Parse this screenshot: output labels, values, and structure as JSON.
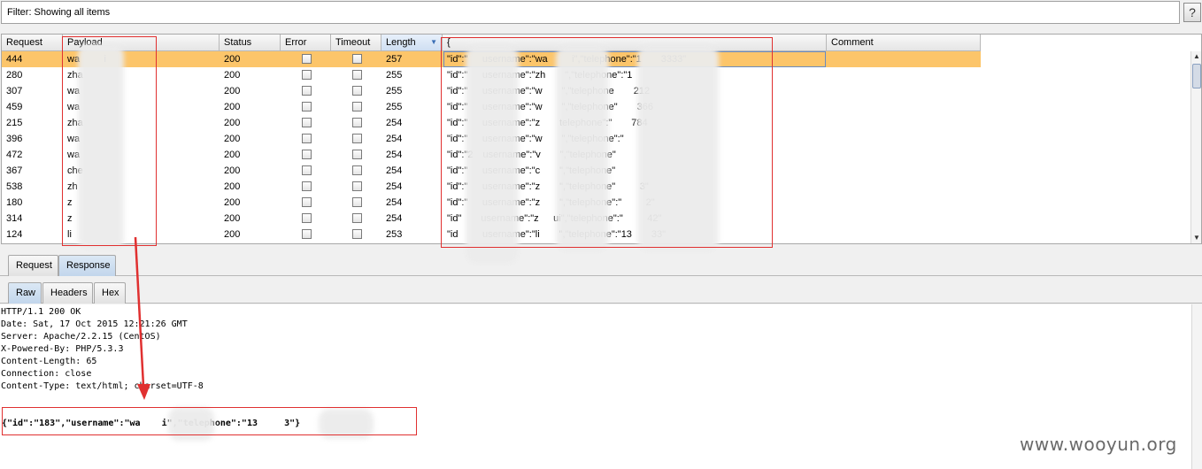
{
  "filter": {
    "text": "Filter:  Showing all items",
    "help_label": "?"
  },
  "table": {
    "columns": [
      "Request",
      "Payload",
      "Status",
      "Error",
      "Timeout",
      "Length",
      "{",
      "Comment"
    ],
    "sorted_column": "Length",
    "rows": [
      {
        "request": "444",
        "payload": "wa     i",
        "status": "200",
        "length": "257",
        "response": "\"id\":\"   username\":\"wa     i\",\"telephone\":\"1    3333\"",
        "selected": true
      },
      {
        "request": "280",
        "payload": "zha",
        "status": "200",
        "length": "255",
        "response": "\"id\":\"   username\":\"zh    \",\"telephone\":\"1    ",
        "selected": false
      },
      {
        "request": "307",
        "payload": "wa",
        "status": "200",
        "length": "255",
        "response": "\"id\":\"   username\":\"w    \",\"telephone    212",
        "selected": false
      },
      {
        "request": "459",
        "payload": "wa",
        "status": "200",
        "length": "255",
        "response": "\"id\":\"   username\":\"w    \",\"telephone\"    366",
        "selected": false
      },
      {
        "request": "215",
        "payload": "zha",
        "status": "200",
        "length": "254",
        "response": "\"id\":\"   username\":\"z    telephone\":\"    784",
        "selected": false
      },
      {
        "request": "396",
        "payload": "wa",
        "status": "200",
        "length": "254",
        "response": "\"id\":\"   username\":\"w    \",\"telephone\":\"    ",
        "selected": false
      },
      {
        "request": "472",
        "payload": "wa",
        "status": "200",
        "length": "254",
        "response": "\"id\":\"2  username\":\"v    \",\"telephone\"    ",
        "selected": false
      },
      {
        "request": "367",
        "payload": "che",
        "status": "200",
        "length": "254",
        "response": "\"id\":\"   username\":\"c    \",\"telephone\"    ",
        "selected": false
      },
      {
        "request": "538",
        "payload": "zh",
        "status": "200",
        "length": "254",
        "response": "\"id\":\"   username\":\"z    \",\"telephone\"     3\"",
        "selected": false
      },
      {
        "request": "180",
        "payload": "z",
        "status": "200",
        "length": "254",
        "response": "\"id\":\"   username\":\"z    \",\"telephone\":\"     2\"",
        "selected": false
      },
      {
        "request": "314",
        "payload": "z",
        "status": "200",
        "length": "254",
        "response": "\"id\"    username\":\"z   ui\",\"telephone\":\"     42\"",
        "selected": false
      },
      {
        "request": "124",
        "payload": "li",
        "status": "200",
        "length": "253",
        "response": "\"id     username\":\"li    \",\"telephone\":\"13    33\"",
        "selected": false
      }
    ]
  },
  "tabs": {
    "request": "Request",
    "response": "Response",
    "active": "Response"
  },
  "subtabs": {
    "raw": "Raw",
    "headers": "Headers",
    "hex": "Hex",
    "active": "Raw"
  },
  "raw": {
    "lines": [
      "HTTP/1.1 200 OK",
      "Date: Sat, 17 Oct 2015 12:21:26 GMT",
      "Server: Apache/2.2.15 (CentOS)",
      "X-Powered-By: PHP/5.3.3",
      "Content-Length: 65",
      "Connection: close",
      "Content-Type: text/html; charset=UTF-8"
    ],
    "body": "{\"id\":\"183\",\"username\":\"wa    i\",\"telephone\":\"13     3\"}"
  },
  "watermark": "www.wooyun.org",
  "colors": {
    "selected_row": "#fcc56a",
    "annotation": "#e03030"
  }
}
